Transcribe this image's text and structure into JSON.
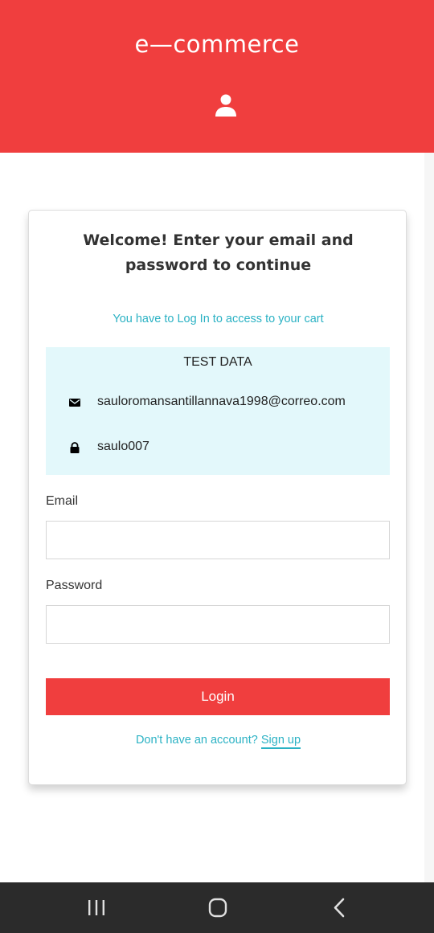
{
  "header": {
    "title": "e—commerce",
    "user_icon": "user-icon",
    "background": "#f03e3e"
  },
  "card": {
    "welcome": "Welcome! Enter your email and password to continue",
    "notice": "You have to Log In to access to your cart",
    "test_data": {
      "title": "TEST DATA",
      "email_icon": "envelope-icon",
      "email": "sauloromansantillannava1998@correo.com",
      "password_icon": "lock-icon",
      "password": "saulo007"
    },
    "email_label": "Email",
    "email_value": "",
    "password_label": "Password",
    "password_value": "",
    "login_label": "Login",
    "signup_prompt": "Don't have an account?",
    "signup_link": "Sign up"
  },
  "nav_bar": {
    "recents_icon": "recents-icon",
    "home_icon": "home-icon",
    "back_icon": "back-icon"
  },
  "colors": {
    "accent": "#f03e3e",
    "link": "#2bb2c4",
    "test_box": "#e3f8fb"
  }
}
